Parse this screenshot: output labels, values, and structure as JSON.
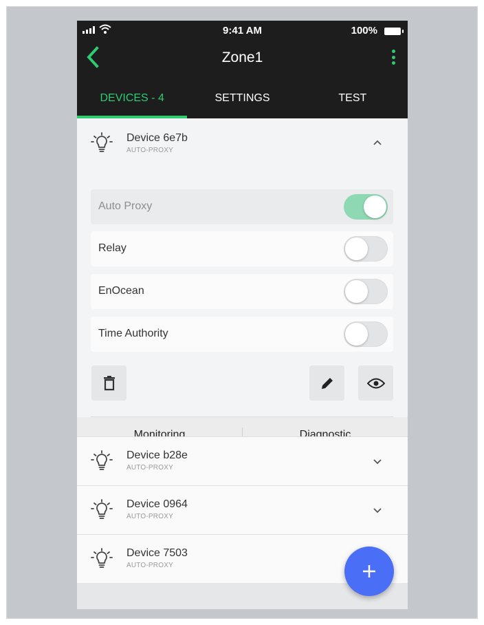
{
  "status_bar": {
    "time": "9:41 AM",
    "battery": "100%"
  },
  "header": {
    "title": "Zone1"
  },
  "tabs": [
    {
      "label": "DEVICES - 4",
      "active": true
    },
    {
      "label": "SETTINGS",
      "active": false
    },
    {
      "label": "TEST",
      "active": false
    }
  ],
  "expanded_device": {
    "name": "Device 6e7b",
    "subtitle": "AUTO-PROXY",
    "options": [
      {
        "label": "Auto Proxy",
        "on": true,
        "disabled": true
      },
      {
        "label": "Relay",
        "on": false,
        "disabled": false
      },
      {
        "label": "EnOcean",
        "on": false,
        "disabled": false
      },
      {
        "label": "Time Authority",
        "on": false,
        "disabled": false
      }
    ],
    "subtabs": [
      "Monitoring",
      "Diagnostic"
    ]
  },
  "devices": [
    {
      "name": "Device b28e",
      "subtitle": "AUTO-PROXY"
    },
    {
      "name": "Device 0964",
      "subtitle": "AUTO-PROXY"
    },
    {
      "name": "Device 7503",
      "subtitle": "AUTO-PROXY"
    }
  ],
  "colors": {
    "accent": "#2ecc71",
    "fab": "#4a6ef5",
    "topbar": "#1d1d1d"
  },
  "icons": [
    "back-arrow-icon",
    "more-vert-icon",
    "bulb-icon",
    "chevron-up-icon",
    "chevron-down-icon",
    "trash-icon",
    "pencil-icon",
    "eye-icon",
    "plus-icon"
  ]
}
